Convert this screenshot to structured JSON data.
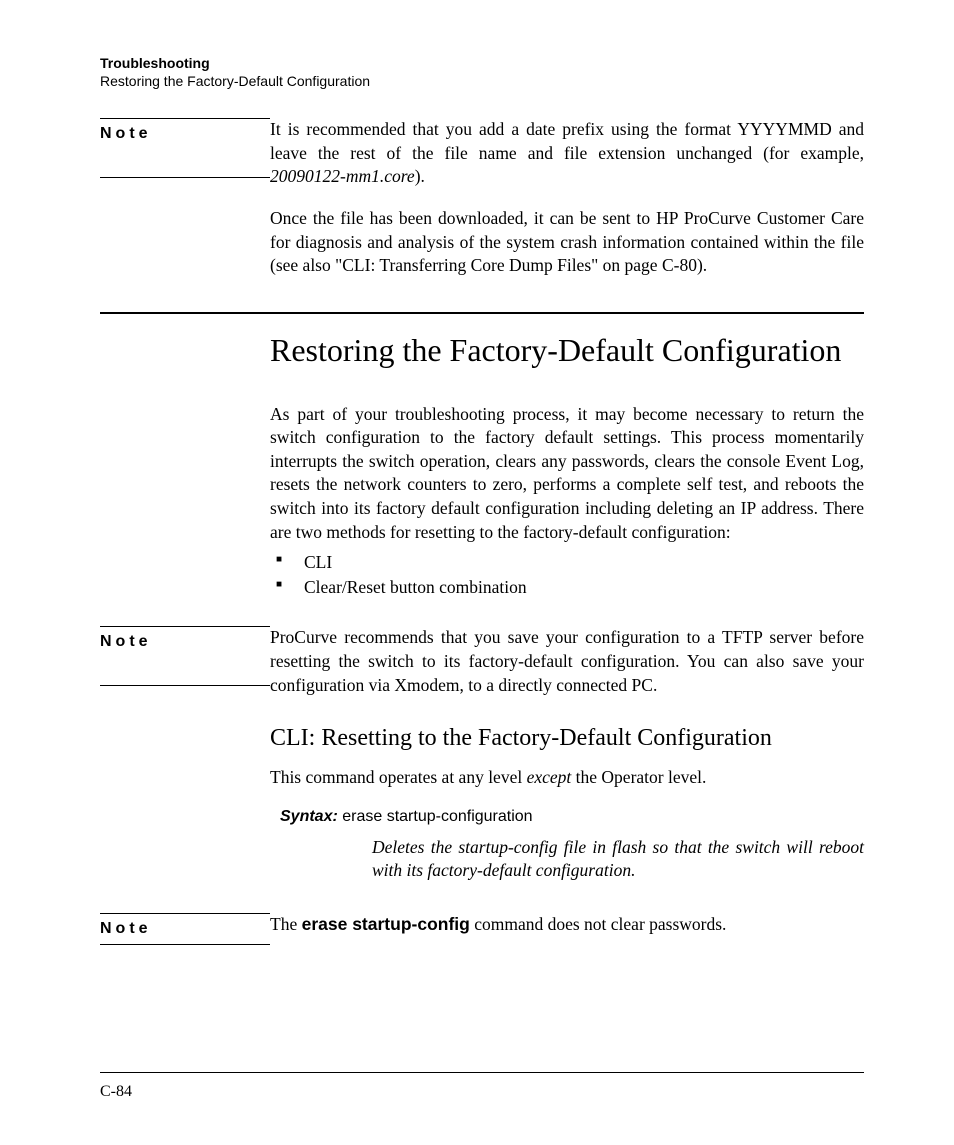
{
  "running_head": {
    "title": "Troubleshooting",
    "subtitle": "Restoring the Factory-Default Configuration"
  },
  "note1": {
    "label": "Note",
    "text_a": "It is recommended that you add a date prefix using the format YYYYMMD and leave the rest of the file name and file extension unchanged (for example, ",
    "text_ital": "20090122-mm1.core",
    "text_b": ")."
  },
  "after_note1": "Once the file has been downloaded, it can be sent to HP ProCurve Customer Care for diagnosis and analysis of the system crash information contained within the file (see also \"CLI: Transferring Core Dump Files\" on page C-80).",
  "section_title": "Restoring the Factory-Default Configuration",
  "section_intro": "As part of your troubleshooting process, it may become necessary to return the switch configuration to the factory default settings. This process momentarily interrupts the switch operation, clears any passwords, clears the console Event Log, resets the network counters to zero, performs a complete self test, and reboots the switch into its factory default configuration including deleting an IP address. There are two methods for resetting to the factory-default configuration:",
  "methods": [
    "CLI",
    "Clear/Reset button combination"
  ],
  "note2": {
    "label": "Note",
    "text": "ProCurve recommends that you save your configuration to a TFTP server before resetting the switch to its factory-default configuration. You can also save your configuration via Xmodem, to a directly connected PC."
  },
  "subsection_title": "CLI: Resetting to the Factory-Default Configuration",
  "sub_intro_a": "This command operates at any level ",
  "sub_intro_ital": "except",
  "sub_intro_b": " the Operator level.",
  "syntax": {
    "keyword": "Syntax:",
    "command": " erase startup-configuration",
    "desc": "Deletes the startup-config file in flash so that the switch will reboot with its factory-default configuration."
  },
  "note3": {
    "label": "Note",
    "text_a": "The ",
    "text_bold": "erase startup-config",
    "text_b": " command does not clear passwords."
  },
  "page_number": "C-84"
}
